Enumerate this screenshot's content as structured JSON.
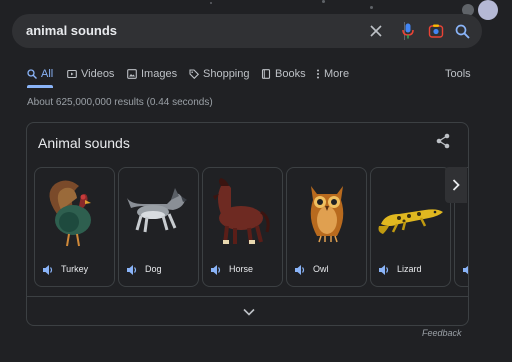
{
  "search": {
    "query": "animal sounds"
  },
  "tabs": [
    {
      "label": "All",
      "icon": "search-icon",
      "active": true
    },
    {
      "label": "Videos",
      "icon": "video-icon",
      "active": false
    },
    {
      "label": "Images",
      "icon": "image-icon",
      "active": false
    },
    {
      "label": "Shopping",
      "icon": "tag-icon",
      "active": false
    },
    {
      "label": "Books",
      "icon": "book-icon",
      "active": false
    },
    {
      "label": "More",
      "icon": "more-vert-icon",
      "active": false
    }
  ],
  "tools_label": "Tools",
  "result_stats": "About 625,000,000 results (0.44 seconds)",
  "card": {
    "title": "Animal sounds",
    "animals": [
      {
        "name": "Turkey",
        "icon": "turkey-illustration"
      },
      {
        "name": "Dog",
        "icon": "dog-illustration"
      },
      {
        "name": "Horse",
        "icon": "horse-illustration"
      },
      {
        "name": "Owl",
        "icon": "owl-illustration"
      },
      {
        "name": "Lizard",
        "icon": "lizard-illustration"
      }
    ]
  },
  "feedback_label": "Feedback",
  "colors": {
    "background": "#202124",
    "search_bar": "#303134",
    "accent_blue": "#8ab4f8",
    "mic_red": "#ea4335",
    "text_primary": "#e8eaed",
    "text_secondary": "#9aa0a6"
  }
}
